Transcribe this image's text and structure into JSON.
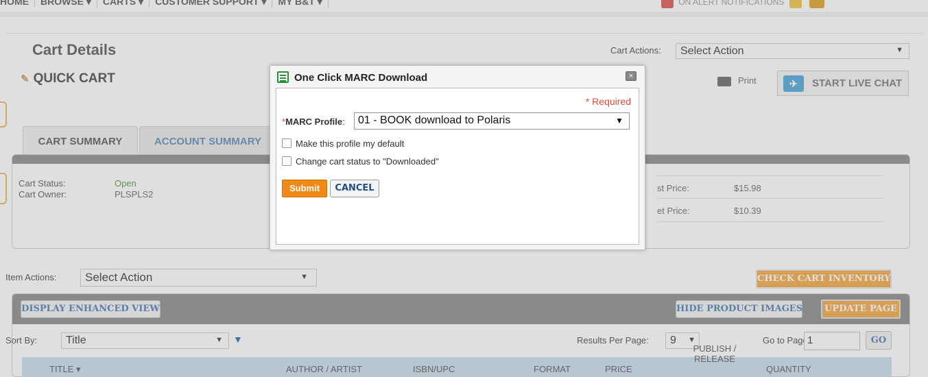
{
  "topnav": {
    "items": [
      "HOME",
      "BROWSE ▾",
      "CARTS ▾",
      "CUSTOMER SUPPORT ▾",
      "MY B&T ▾"
    ],
    "right_text": "ON ALERT NOTIFICATIONS"
  },
  "header": {
    "title": "Cart Details",
    "cart_actions_label": "Cart Actions:",
    "cart_actions_value": "Select Action",
    "cart_name": "QUICK CART",
    "print_label": "Print",
    "live_chat_label": "START LIVE CHAT"
  },
  "tabs": [
    {
      "label": "CART SUMMARY"
    },
    {
      "label": "ACCOUNT SUMMARY"
    }
  ],
  "summary": {
    "status_label": "Cart Status:",
    "status_value": "Open",
    "owner_label": "Cart Owner:",
    "owner_value": "PLSPLS2",
    "list_price_label": "st Price:",
    "list_price_value": "$15.98",
    "net_price_label": "et Price:",
    "net_price_value": "$10.39"
  },
  "items": {
    "actions_label": "Item Actions:",
    "actions_value": "Select Action",
    "check_inventory": "CHECK CART INVENTORY",
    "display_enhanced": "DISPLAY ENHANCED VIEW",
    "hide_images": "HIDE PRODUCT IMAGES",
    "update_page": "UPDATE PAGE",
    "sort_label": "Sort By:",
    "sort_value": "Title",
    "rpp_label": "Results Per Page:",
    "rpp_value": "9",
    "goto_label": "Go to Page:",
    "goto_value": "1",
    "go_button": "GO",
    "columns": [
      "TITLE ▾",
      "AUTHOR / ARTIST",
      "ISBN/UPC",
      "FORMAT",
      "PRICE",
      "PUBLISH / RELEASE",
      "QUANTITY"
    ]
  },
  "modal": {
    "title": "One Click MARC Download",
    "close": "×",
    "required": "* Required",
    "profile_star": "*",
    "profile_label": "MARC Profile",
    "profile_value": "01 - BOOK download to Polaris",
    "checkbox_default": "Make this profile my default",
    "checkbox_status": "Change cart status to \"Downloaded\"",
    "submit": "Submit",
    "cancel": "CANCEL"
  }
}
